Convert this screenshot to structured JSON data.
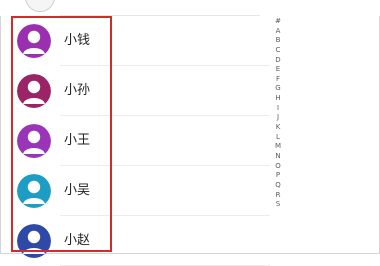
{
  "contacts": [
    {
      "name": "小钱",
      "avatar_color": "#9a2fb0",
      "avatar_color_dark": "#6b1a86"
    },
    {
      "name": "小孙",
      "avatar_color": "#9a2466",
      "avatar_color_dark": "#6a1545"
    },
    {
      "name": "小王",
      "avatar_color": "#9a34b8",
      "avatar_color_dark": "#6e1f8c"
    },
    {
      "name": "小吴",
      "avatar_color": "#1d9dc4",
      "avatar_color_dark": "#137394"
    },
    {
      "name": "小赵",
      "avatar_color": "#2e4aa6",
      "avatar_color_dark": "#1e3380"
    }
  ],
  "index_letters": [
    "#",
    "A",
    "B",
    "C",
    "D",
    "E",
    "F",
    "G",
    "H",
    "I",
    "J",
    "K",
    "L",
    "M",
    "N",
    "O",
    "P",
    "Q",
    "R",
    "S"
  ],
  "colors": {
    "highlight": "#d22b2b",
    "divider": "#ececec"
  }
}
